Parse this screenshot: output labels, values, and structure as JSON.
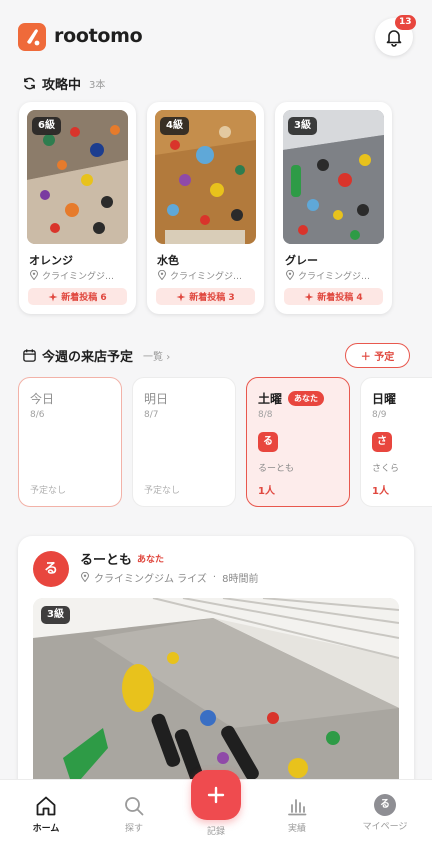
{
  "app": {
    "name": "rootomo",
    "notification_count": "13"
  },
  "attempting": {
    "title": "攻略中",
    "count": "3本",
    "cards": [
      {
        "grade": "6級",
        "name": "オレンジ",
        "gym": "クライミングジ…",
        "new_posts": "新着投稿 6"
      },
      {
        "grade": "4級",
        "name": "水色",
        "gym": "クライミングジ…",
        "new_posts": "新着投稿 3"
      },
      {
        "grade": "3級",
        "name": "グレー",
        "gym": "クライミングジ…",
        "new_posts": "新着投稿 4"
      }
    ]
  },
  "week": {
    "title": "今週の来店予定",
    "list_link": "一覧",
    "add_label": "＋ 予定",
    "days": [
      {
        "name": "今日",
        "date": "8/6",
        "empty_text": "予定なし"
      },
      {
        "name": "明日",
        "date": "8/7",
        "empty_text": "予定なし"
      },
      {
        "name": "土曜",
        "date": "8/8",
        "you_tag": "あなた",
        "avatar": "る",
        "user": "るーとも",
        "count": "1人"
      },
      {
        "name": "日曜",
        "date": "8/9",
        "avatar": "さ",
        "user": "さくら",
        "count": "1人"
      }
    ]
  },
  "post": {
    "avatar": "る",
    "user": "るーとも",
    "you_tag": "あなた",
    "gym": "クライミングジム ライズ",
    "time": "8時間前",
    "grade": "3級"
  },
  "tabs": {
    "home": "ホーム",
    "search": "探す",
    "record": "記録",
    "stats": "実績",
    "mypage": "マイページ",
    "mypage_avatar": "る"
  },
  "colors": {
    "accent": "#e8463e",
    "brand": "#ef6a3a",
    "background": "#f6f6f7"
  }
}
